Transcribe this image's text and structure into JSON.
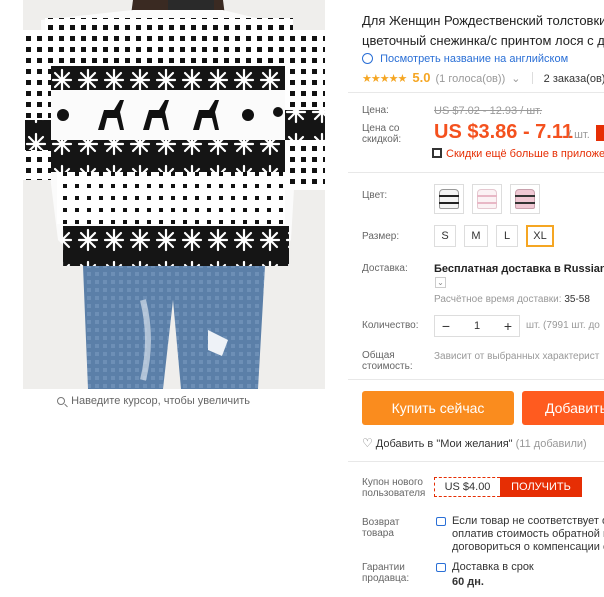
{
  "image": {
    "zoom_hint": "Наведите курсор, чтобы увеличить"
  },
  "product": {
    "title_line1": "Для Женщин Рождественский толстовки",
    "title_line2": "цветочный снежинка/с принтом лося с д",
    "translate_link": "Посмотреть название на английском",
    "stars": "★★★★★",
    "rating": "5.0",
    "votes": "(1 голоса(ов))",
    "orders": "2 заказа(ов)"
  },
  "price": {
    "label_price": "Цена:",
    "old_price": "US $7.02 - 12.93 / шт.",
    "label_discount": "Цена со скидкой:",
    "new_price": "US $3.86 - 7.11",
    "per_unit": "/ шт.",
    "app_discount": "Скидки ещё больше в приложен"
  },
  "options": {
    "color_label": "Цвет:",
    "colors": [
      "black-white",
      "white-pink",
      "pink-black"
    ],
    "size_label": "Размер:",
    "sizes": [
      "S",
      "M",
      "L",
      "XL"
    ],
    "selected_size": "XL"
  },
  "shipping": {
    "label": "Доставка:",
    "method": "Бесплатная доставка в Russian Fe",
    "estimate_label": "Расчётное время доставки:",
    "estimate_value": "35-58"
  },
  "quantity": {
    "label": "Количество:",
    "value": "1",
    "note": "шт. (7991 шт. до"
  },
  "total": {
    "label": "Общая стоимость:",
    "value": "Зависит от выбранных характерист"
  },
  "actions": {
    "buy": "Купить сейчас",
    "add_to_cart": "Добавить",
    "wishlist": "Добавить в \"Мои желания\"",
    "wishlist_count": "(11 добавили)"
  },
  "coupon": {
    "label": "Купон нового пользователя",
    "amount": "US $4.00",
    "button": "ПОЛУЧИТЬ"
  },
  "returns": {
    "label": "Возврат товара",
    "line1": "Если товар не соответствует оп",
    "line2": "оплатив стоимость обратной пе",
    "line3": "договориться о компенсации с"
  },
  "guarantee": {
    "label": "Гарантии продавца:",
    "line1": "Доставка в срок",
    "line2": "60 дн."
  },
  "colors": {
    "accent_orange": "#fa8c1e",
    "price_red": "#f4511e",
    "coupon_red": "#e62e04",
    "link_blue": "#2a6fd6",
    "star_gold": "#f5a623"
  }
}
